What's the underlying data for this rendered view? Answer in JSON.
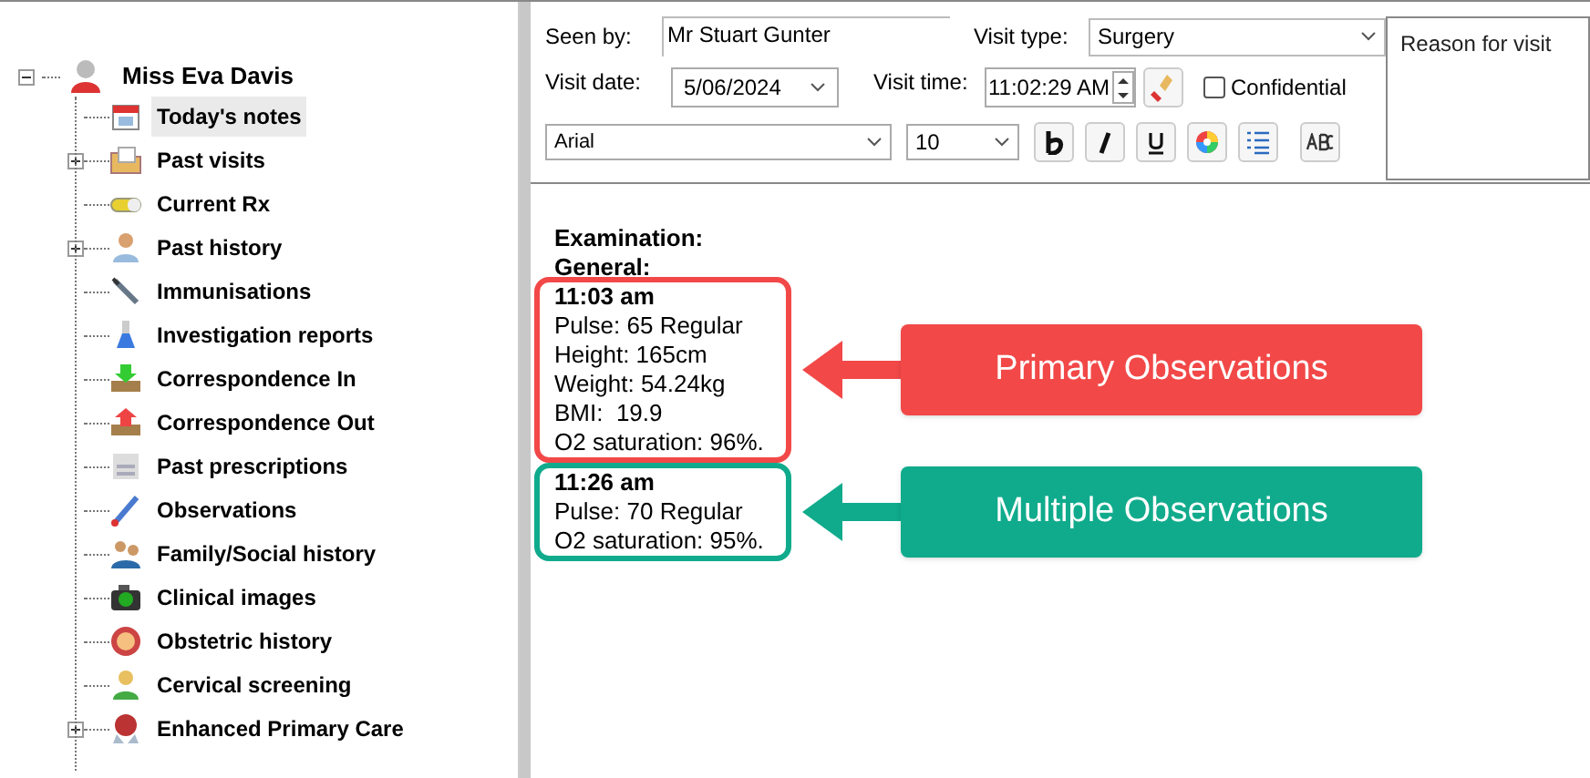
{
  "tree": {
    "label": "Miss Eva Davis",
    "expanded": true,
    "children": [
      {
        "label": "Today's notes",
        "selected": true
      },
      {
        "label": "Past visits",
        "selected": false,
        "expanded": false
      },
      {
        "label": "Current Rx",
        "selected": false
      },
      {
        "label": "Past history",
        "selected": false,
        "expanded": false
      },
      {
        "label": "Immunisations",
        "selected": false
      },
      {
        "label": "Investigation reports",
        "selected": false
      },
      {
        "label": "Correspondence In",
        "selected": false
      },
      {
        "label": "Correspondence Out",
        "selected": false
      },
      {
        "label": "Past prescriptions",
        "selected": false
      },
      {
        "label": "Observations",
        "selected": false
      },
      {
        "label": "Family/Social history",
        "selected": false
      },
      {
        "label": "Clinical images",
        "selected": false
      },
      {
        "label": "Obstetric history",
        "selected": false
      },
      {
        "label": "Cervical screening",
        "selected": false
      },
      {
        "label": "Enhanced Primary Care",
        "selected": false,
        "expanded": false
      }
    ]
  },
  "visit": {
    "seen_by_label": "Seen by:",
    "seen_by": "Mr Stuart Gunter",
    "visit_type_label": "Visit type:",
    "visit_type": "Surgery",
    "visit_date_label": "Visit date:",
    "visit_date": "5/06/2024",
    "visit_time_label": "Visit time:",
    "visit_time": "11:02:29 AM",
    "confidential": {
      "label": "Confidential",
      "checked": false
    },
    "reason_placeholder": "Reason for visit"
  },
  "format": {
    "font": "Arial",
    "size": "10"
  },
  "notes": {
    "headings": [
      "Examination:",
      "General:"
    ],
    "groups": [
      {
        "time": "11:03 am",
        "lines": [
          "Pulse: 65 Regular",
          "Height: 165cm",
          "Weight: 54.24kg",
          "BMI:  19.9",
          "O2 saturation: 96%."
        ],
        "callout": "Primary Observations",
        "color": "#f24848"
      },
      {
        "time": "11:26 am",
        "lines": [
          "Pulse: 70 Regular",
          "O2 saturation: 95%."
        ],
        "callout": "Multiple Observations",
        "color": "#10ab8c"
      }
    ]
  }
}
